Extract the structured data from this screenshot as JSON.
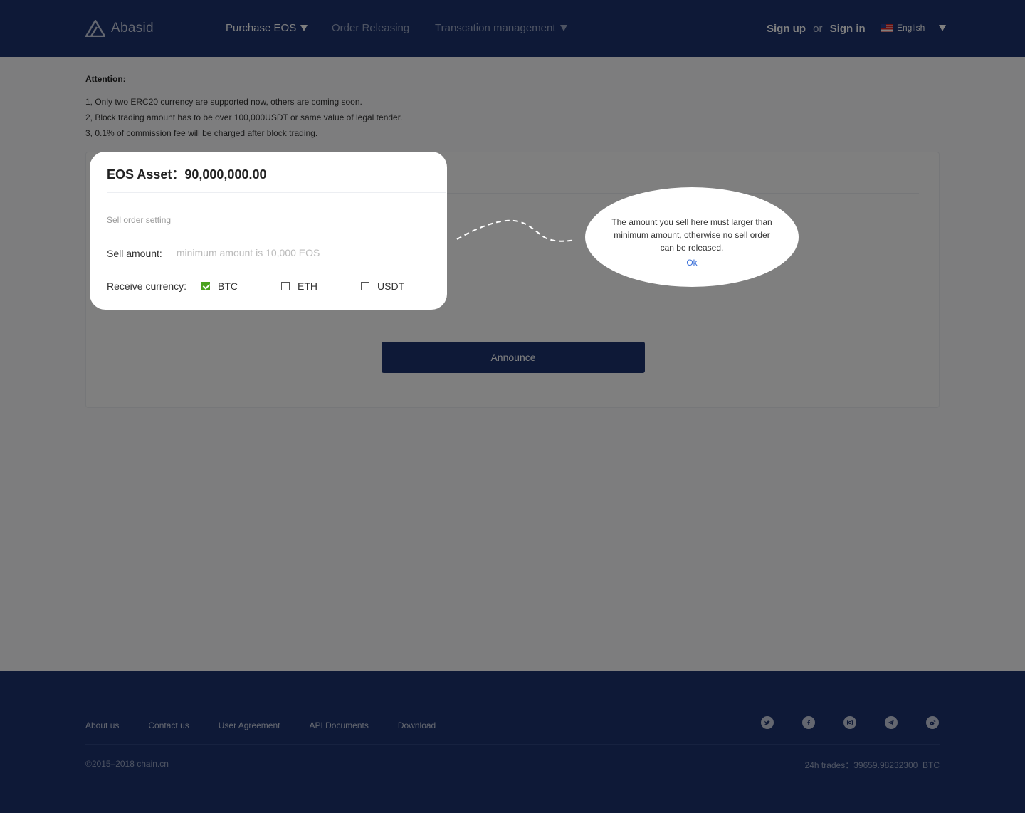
{
  "header": {
    "logo_text": "Abasid",
    "nav": [
      {
        "label": "Purchase EOS"
      },
      {
        "label": "Order Releasing"
      },
      {
        "label": "Transcation management"
      }
    ],
    "sign_up": "Sign up",
    "or": "or",
    "sign_in": "Sign in",
    "language": "English"
  },
  "attention": {
    "title": "Attention:",
    "lines": [
      "1, Only two ERC20 currency are supported now, others are coming soon.",
      "2, Block trading amount has to be over 100,000USDT or same value of legal tender.",
      "3, 0.1% of commission fee will be charged after block trading."
    ]
  },
  "card": {
    "asset_label": "EOS Asset：",
    "asset_value": "90,000,000.00",
    "section_label": "Sell order setting",
    "sell_amount_label": "Sell amount:",
    "sell_amount_value": "",
    "sell_amount_placeholder": "minimum amount is 10,000 EOS",
    "receive_label": "Receive currency:",
    "currencies": [
      {
        "label": "BTC",
        "checked": true
      },
      {
        "label": "ETH",
        "checked": false
      },
      {
        "label": "USDT",
        "checked": false
      }
    ],
    "announce_label": "Announce"
  },
  "tooltip": {
    "text": "The amount you sell here must larger than minimum amount, otherwise no sell order can be released.",
    "ok_label": "Ok"
  },
  "footer": {
    "links": [
      "About us",
      "Contact us",
      "User Agreement",
      "API Documents",
      "Download"
    ],
    "social_icons": [
      "twitter-icon",
      "facebook-icon",
      "instagram-icon",
      "telegram-icon",
      "weibo-icon"
    ],
    "copyright": "©2015–2018  chain.cn",
    "trades_label": "24h trades：",
    "trades_value": "39659.98232300",
    "trades_unit": "BTC"
  },
  "colors": {
    "brand_navy": "#1d336e",
    "check_green": "#4aa21e",
    "link_blue": "#3a6fd8",
    "overlay": "rgba(0,0,0,0.5)"
  }
}
